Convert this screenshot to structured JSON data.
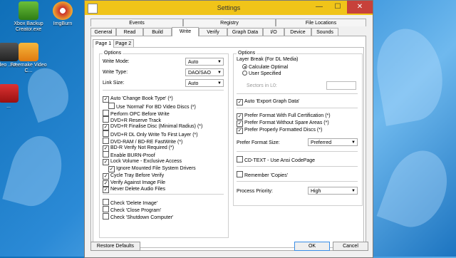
{
  "desktop": {
    "icons": [
      {
        "label": "Xbox Backup Creator.exe",
        "icon": "xbox-icon"
      },
      {
        "label": "ImgBurn",
        "icon": "imgburn-icon"
      },
      {
        "label": "ideo ...U...",
        "icon": "video-icon"
      },
      {
        "label": "Freemake Video C...",
        "icon": "freemake-icon"
      },
      {
        "label": "...",
        "icon": "app-icon"
      }
    ]
  },
  "window": {
    "title": "Settings",
    "controls": {
      "minimize": "—",
      "maximize": "☐",
      "close": "✕"
    }
  },
  "tabs_row1": [
    "Events",
    "Registry",
    "File Locations"
  ],
  "tabs_row2": [
    "General",
    "Read",
    "Build",
    "Write",
    "Verify",
    "Graph Data",
    "I/O",
    "Device",
    "Sounds"
  ],
  "active_tab": "Write",
  "subtabs": [
    "Page 1",
    "Page 2"
  ],
  "active_subtab": "Page 1",
  "options_left": {
    "title": "Options",
    "write_mode": {
      "label": "Write Mode:",
      "value": "Auto"
    },
    "write_type": {
      "label": "Write Type:",
      "value": "DAO/SAO"
    },
    "link_size": {
      "label": "Link Size:",
      "value": "Auto"
    },
    "checks": [
      {
        "label": "Auto 'Change Book Type' (*)",
        "checked": true,
        "indent": 0
      },
      {
        "label": "Use 'Normal' For BD Video Discs (*)",
        "checked": false,
        "indent": 1
      },
      {
        "label": "Perform OPC Before Write",
        "checked": false,
        "indent": 0
      },
      {
        "label": "DVD+R Reserve Track",
        "checked": false,
        "indent": 0
      },
      {
        "label": "DVD+R Finalise Disc (Minimal Radius) (*)",
        "checked": true,
        "indent": 0
      },
      {
        "label": "DVD+R DL Only Write To First Layer (*)",
        "checked": false,
        "indent": 0
      },
      {
        "label": "DVD-RAM / BD-RE FastWrite (*)",
        "checked": false,
        "indent": 0
      },
      {
        "label": "BD-R Verify Not Required (*)",
        "checked": true,
        "indent": 0
      },
      {
        "label": "Enable BURN-Proof",
        "checked": false,
        "indent": 0
      },
      {
        "label": "Lock Volume - Exclusive Access",
        "checked": true,
        "indent": 0
      },
      {
        "label": "Ignore Mounted File System Drivers",
        "checked": true,
        "indent": 1
      },
      {
        "label": "Cycle Tray Before Verify",
        "checked": true,
        "indent": 0
      },
      {
        "label": "Verify Against Image File",
        "checked": true,
        "indent": 0
      },
      {
        "label": "Never Delete Audio Files",
        "checked": true,
        "indent": 0
      }
    ],
    "checks2": [
      {
        "label": "Check 'Delete Image'",
        "checked": false
      },
      {
        "label": "Check 'Close Program'",
        "checked": false
      },
      {
        "label": "Check 'Shutdown Computer'",
        "checked": false
      }
    ]
  },
  "options_right": {
    "title": "Options",
    "layer_break_label": "Layer Break (For DL Media)",
    "radio_calc": "Calculate Optimal",
    "radio_user": "User Specified",
    "sectors_label": "Sectors in L0:",
    "auto_export": "Auto 'Export Graph Data'",
    "prefer_checks": [
      "Prefer Format With Full Certification (*)",
      "Prefer Format Without Spare Areas (*)",
      "Prefer Properly Formatted Discs (*)"
    ],
    "prefer_format_size": {
      "label": "Prefer Format Size:",
      "value": "Preferred"
    },
    "cdtext": "CD-TEXT - Use Ansi CodePage",
    "remember_copies": "Remember 'Copies'",
    "process_priority": {
      "label": "Process Priority:",
      "value": "High"
    }
  },
  "buttons": {
    "restore": "Restore Defaults",
    "ok": "OK",
    "cancel": "Cancel"
  }
}
